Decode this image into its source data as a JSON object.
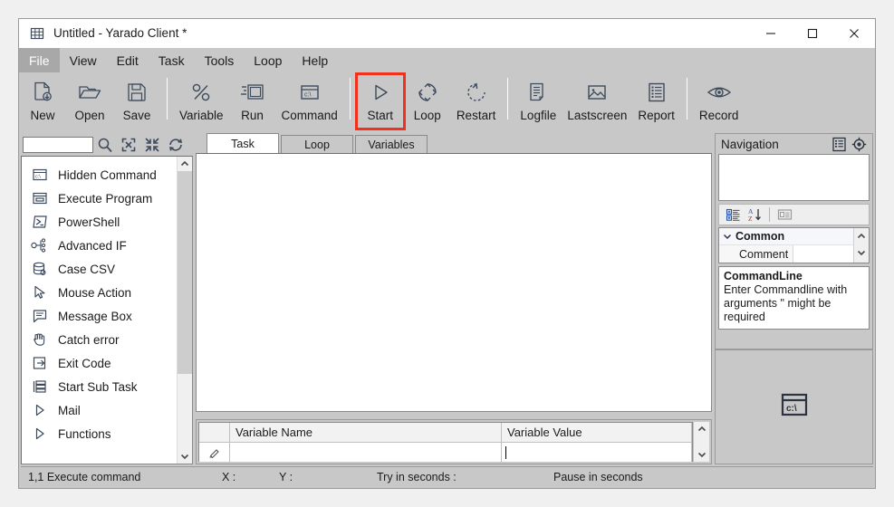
{
  "window": {
    "title": "Untitled  - Yarado Client *",
    "app_icon": "grid-icon",
    "controls": {
      "minimize": "minimize-icon",
      "maximize": "maximize-icon",
      "close": "close-icon"
    }
  },
  "menubar": {
    "items": [
      {
        "label": "File",
        "active": true
      },
      {
        "label": "View",
        "active": false
      },
      {
        "label": "Edit",
        "active": false
      },
      {
        "label": "Task",
        "active": false
      },
      {
        "label": "Tools",
        "active": false
      },
      {
        "label": "Loop",
        "active": false
      },
      {
        "label": "Help",
        "active": false
      }
    ]
  },
  "toolbar": {
    "highlight_color": "#f3301c",
    "items": [
      {
        "label": "New",
        "icon": "new-file-icon",
        "highlight": false
      },
      {
        "label": "Open",
        "icon": "open-folder-icon",
        "highlight": false
      },
      {
        "label": "Save",
        "icon": "floppy-disk-icon",
        "highlight": false
      },
      {
        "separator": true
      },
      {
        "label": "Variable",
        "icon": "percent-icon",
        "highlight": false
      },
      {
        "label": "Run",
        "icon": "run-window-icon",
        "highlight": false
      },
      {
        "label": "Command",
        "icon": "command-prompt-icon",
        "highlight": false
      },
      {
        "separator": true
      },
      {
        "label": "Start",
        "icon": "play-triangle-icon",
        "highlight": true
      },
      {
        "label": "Loop",
        "icon": "loop-arrows-icon",
        "highlight": false
      },
      {
        "label": "Restart",
        "icon": "restart-arrow-icon",
        "highlight": false
      },
      {
        "separator": true
      },
      {
        "label": "Logfile",
        "icon": "document-lines-icon",
        "highlight": false
      },
      {
        "label": "Lastscreen",
        "icon": "picture-icon",
        "highlight": false
      },
      {
        "label": "Report",
        "icon": "report-list-icon",
        "highlight": false
      },
      {
        "separator": true
      },
      {
        "label": "Record",
        "icon": "eye-icon",
        "highlight": false
      }
    ]
  },
  "sidebar": {
    "search": {
      "value": "",
      "placeholder": ""
    },
    "search_buttons": [
      {
        "icon": "magnifier-icon",
        "name": "search-button"
      },
      {
        "icon": "expand-all-icon",
        "name": "expand-all-button"
      },
      {
        "icon": "collapse-all-icon",
        "name": "collapse-all-button"
      },
      {
        "icon": "refresh-icon",
        "name": "refresh-button"
      }
    ],
    "items": [
      {
        "label": "Hidden Command",
        "icon": "command-prompt-icon"
      },
      {
        "label": "Execute Program",
        "icon": "program-window-icon"
      },
      {
        "label": "PowerShell",
        "icon": "powershell-icon"
      },
      {
        "label": "Advanced IF",
        "icon": "branch-icon"
      },
      {
        "label": "Case CSV",
        "icon": "database-icon"
      },
      {
        "label": "Mouse Action",
        "icon": "cursor-icon"
      },
      {
        "label": "Message Box",
        "icon": "speech-bubble-icon"
      },
      {
        "label": "Catch error",
        "icon": "hand-icon"
      },
      {
        "label": "Exit Code",
        "icon": "exit-arrow-icon"
      },
      {
        "label": "Start Sub Task",
        "icon": "subtask-icon"
      },
      {
        "label": "Mail",
        "icon": "chevron-right-icon"
      },
      {
        "label": "Functions",
        "icon": "chevron-right-icon"
      }
    ]
  },
  "center": {
    "tabs": [
      {
        "label": "Task",
        "active": true
      },
      {
        "label": "Loop",
        "active": false
      },
      {
        "label": "Variables",
        "active": false
      }
    ],
    "variables_table": {
      "columns": [
        "Variable Name",
        "Variable Value"
      ],
      "rows": [
        {
          "name": "",
          "value": ""
        }
      ]
    }
  },
  "navigation": {
    "title": "Navigation",
    "header_buttons": [
      {
        "icon": "list-view-icon",
        "name": "list-view-button"
      },
      {
        "icon": "target-icon",
        "name": "locate-button"
      }
    ],
    "property_toolbar": [
      {
        "icon": "categorized-icon",
        "name": "categorized-button"
      },
      {
        "icon": "alphabetical-sort-icon",
        "name": "sort-alphabetical-button"
      },
      {
        "icon": "property-pages-icon",
        "name": "property-pages-button"
      }
    ],
    "property_grid": {
      "category": "Common",
      "rows": [
        {
          "key": "Comment",
          "value": ""
        }
      ]
    },
    "description": {
      "title": "CommandLine",
      "text": "Enter Commandline with arguments \" might be required"
    }
  },
  "preview": {
    "icon": "command-prompt-icon"
  },
  "statusbar": {
    "position": "1,1 Execute command",
    "x_label": "X :",
    "y_label": "Y :",
    "try_label": "Try in seconds :",
    "pause_label": "Pause in seconds"
  }
}
